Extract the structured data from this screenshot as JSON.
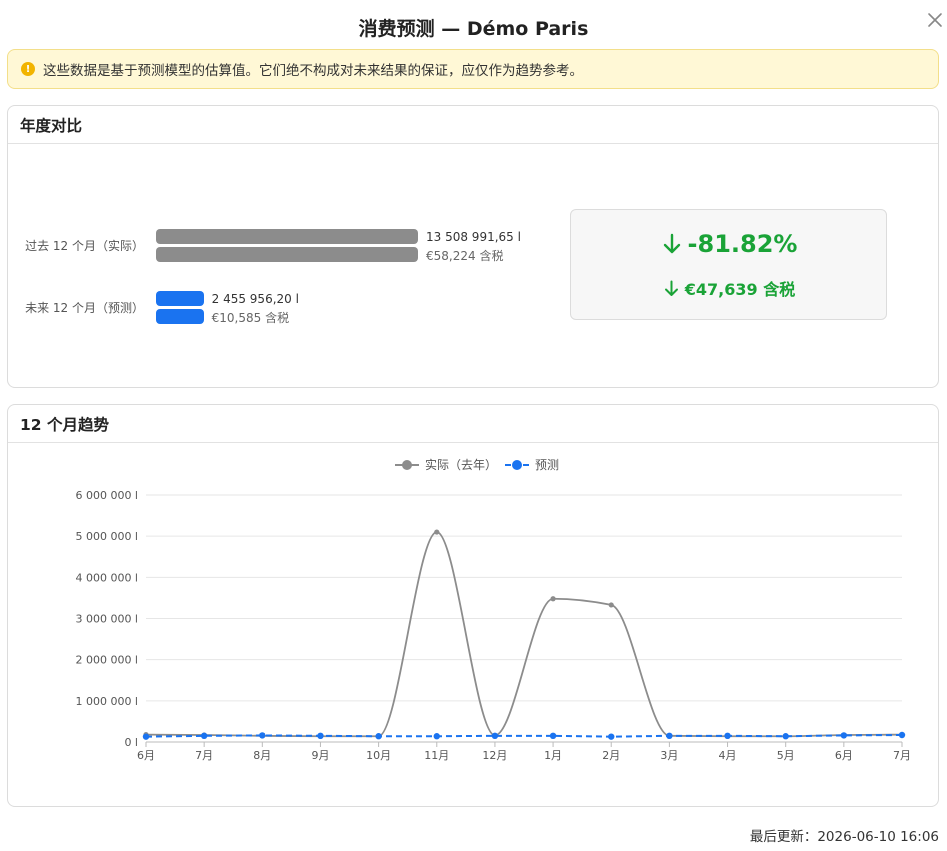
{
  "dialog": {
    "title": "消费预测 — Démo Paris",
    "close_icon": "close-icon"
  },
  "alert": {
    "icon": "warning-icon",
    "icon_glyph": "!",
    "text": "这些数据是基于预测模型的估算值。它们绝不构成对未来结果的保证，应仅作为趋势参考。"
  },
  "comparison": {
    "title": "年度对比",
    "past": {
      "label": "过去 12 个月（实际）",
      "volume": "13 508 991,65 l",
      "cost": "€58,224 含税",
      "volume_value": 13508991.65,
      "cost_value": 58224
    },
    "future": {
      "label": "未来 12 个月（预测）",
      "volume": "2 455 956,20 l",
      "cost": "€10,585 含税",
      "volume_value": 2455956.2,
      "cost_value": 10585
    },
    "change_percent": "-81.82%",
    "change_amount": "€47,639 含税",
    "change_color": "#1aa337"
  },
  "trend": {
    "title": "12 个月趋势"
  },
  "chart_data": {
    "type": "line",
    "x": [
      "6月",
      "7月",
      "8月",
      "9月",
      "10月",
      "11月",
      "12月",
      "1月",
      "2月",
      "3月",
      "4月",
      "5月",
      "6月",
      "7月"
    ],
    "series": [
      {
        "name": "实际（去年）",
        "color": "#8c8c8c",
        "dashed": false,
        "smooth": true,
        "values": [
          180000,
          170000,
          150000,
          140000,
          140000,
          5100000,
          160000,
          3480000,
          3330000,
          150000,
          140000,
          140000,
          170000,
          180000
        ]
      },
      {
        "name": "预测",
        "color": "#1a73f0",
        "dashed": true,
        "smooth": false,
        "values": [
          130000,
          150000,
          160000,
          150000,
          140000,
          140000,
          150000,
          150000,
          130000,
          150000,
          150000,
          140000,
          160000,
          170000
        ]
      }
    ],
    "yticks": [
      0,
      1000000,
      2000000,
      3000000,
      4000000,
      5000000,
      6000000
    ],
    "ytick_labels": [
      "0 l",
      "1 000 000 l",
      "2 000 000 l",
      "3 000 000 l",
      "4 000 000 l",
      "5 000 000 l",
      "6 000 000 l"
    ],
    "ylim": [
      0,
      6000000
    ],
    "grid": true,
    "legend_position": "top-center"
  },
  "footer": {
    "last_updated": "最后更新：2026-06-10 16:06"
  }
}
